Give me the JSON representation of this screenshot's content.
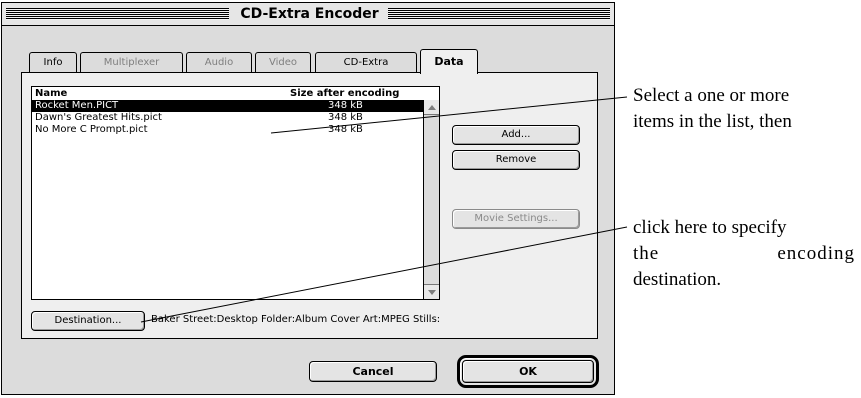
{
  "window": {
    "title": "CD-Extra Encoder"
  },
  "tabs": [
    {
      "label": "Info",
      "enabled": true
    },
    {
      "label": "Multiplexer",
      "enabled": false
    },
    {
      "label": "Audio",
      "enabled": false
    },
    {
      "label": "Video",
      "enabled": false
    },
    {
      "label": "CD-Extra",
      "enabled": true
    },
    {
      "label": "Data",
      "enabled": true,
      "active": true
    }
  ],
  "list": {
    "columns": [
      "Name",
      "Size after encoding"
    ],
    "rows": [
      {
        "name": "Rocket Men.PICT",
        "size": "348 kB",
        "selected": true
      },
      {
        "name": "Dawn's Greatest Hits.pict",
        "size": "348 kB",
        "selected": false
      },
      {
        "name": "No More C Prompt.pict",
        "size": "348 kB",
        "selected": false
      }
    ]
  },
  "buttons": {
    "add": "Add...",
    "remove": "Remove",
    "movie_settings": "Movie Settings...",
    "destination": "Destination...",
    "cancel": "Cancel",
    "ok": "OK"
  },
  "destination_path": "Baker Street:Desktop Folder:Album Cover Art:MPEG Stills:",
  "callouts": {
    "first": [
      "Select a one or more",
      "items in the list, then"
    ],
    "second": [
      "click here to specify",
      "the encoding",
      "destination."
    ]
  }
}
